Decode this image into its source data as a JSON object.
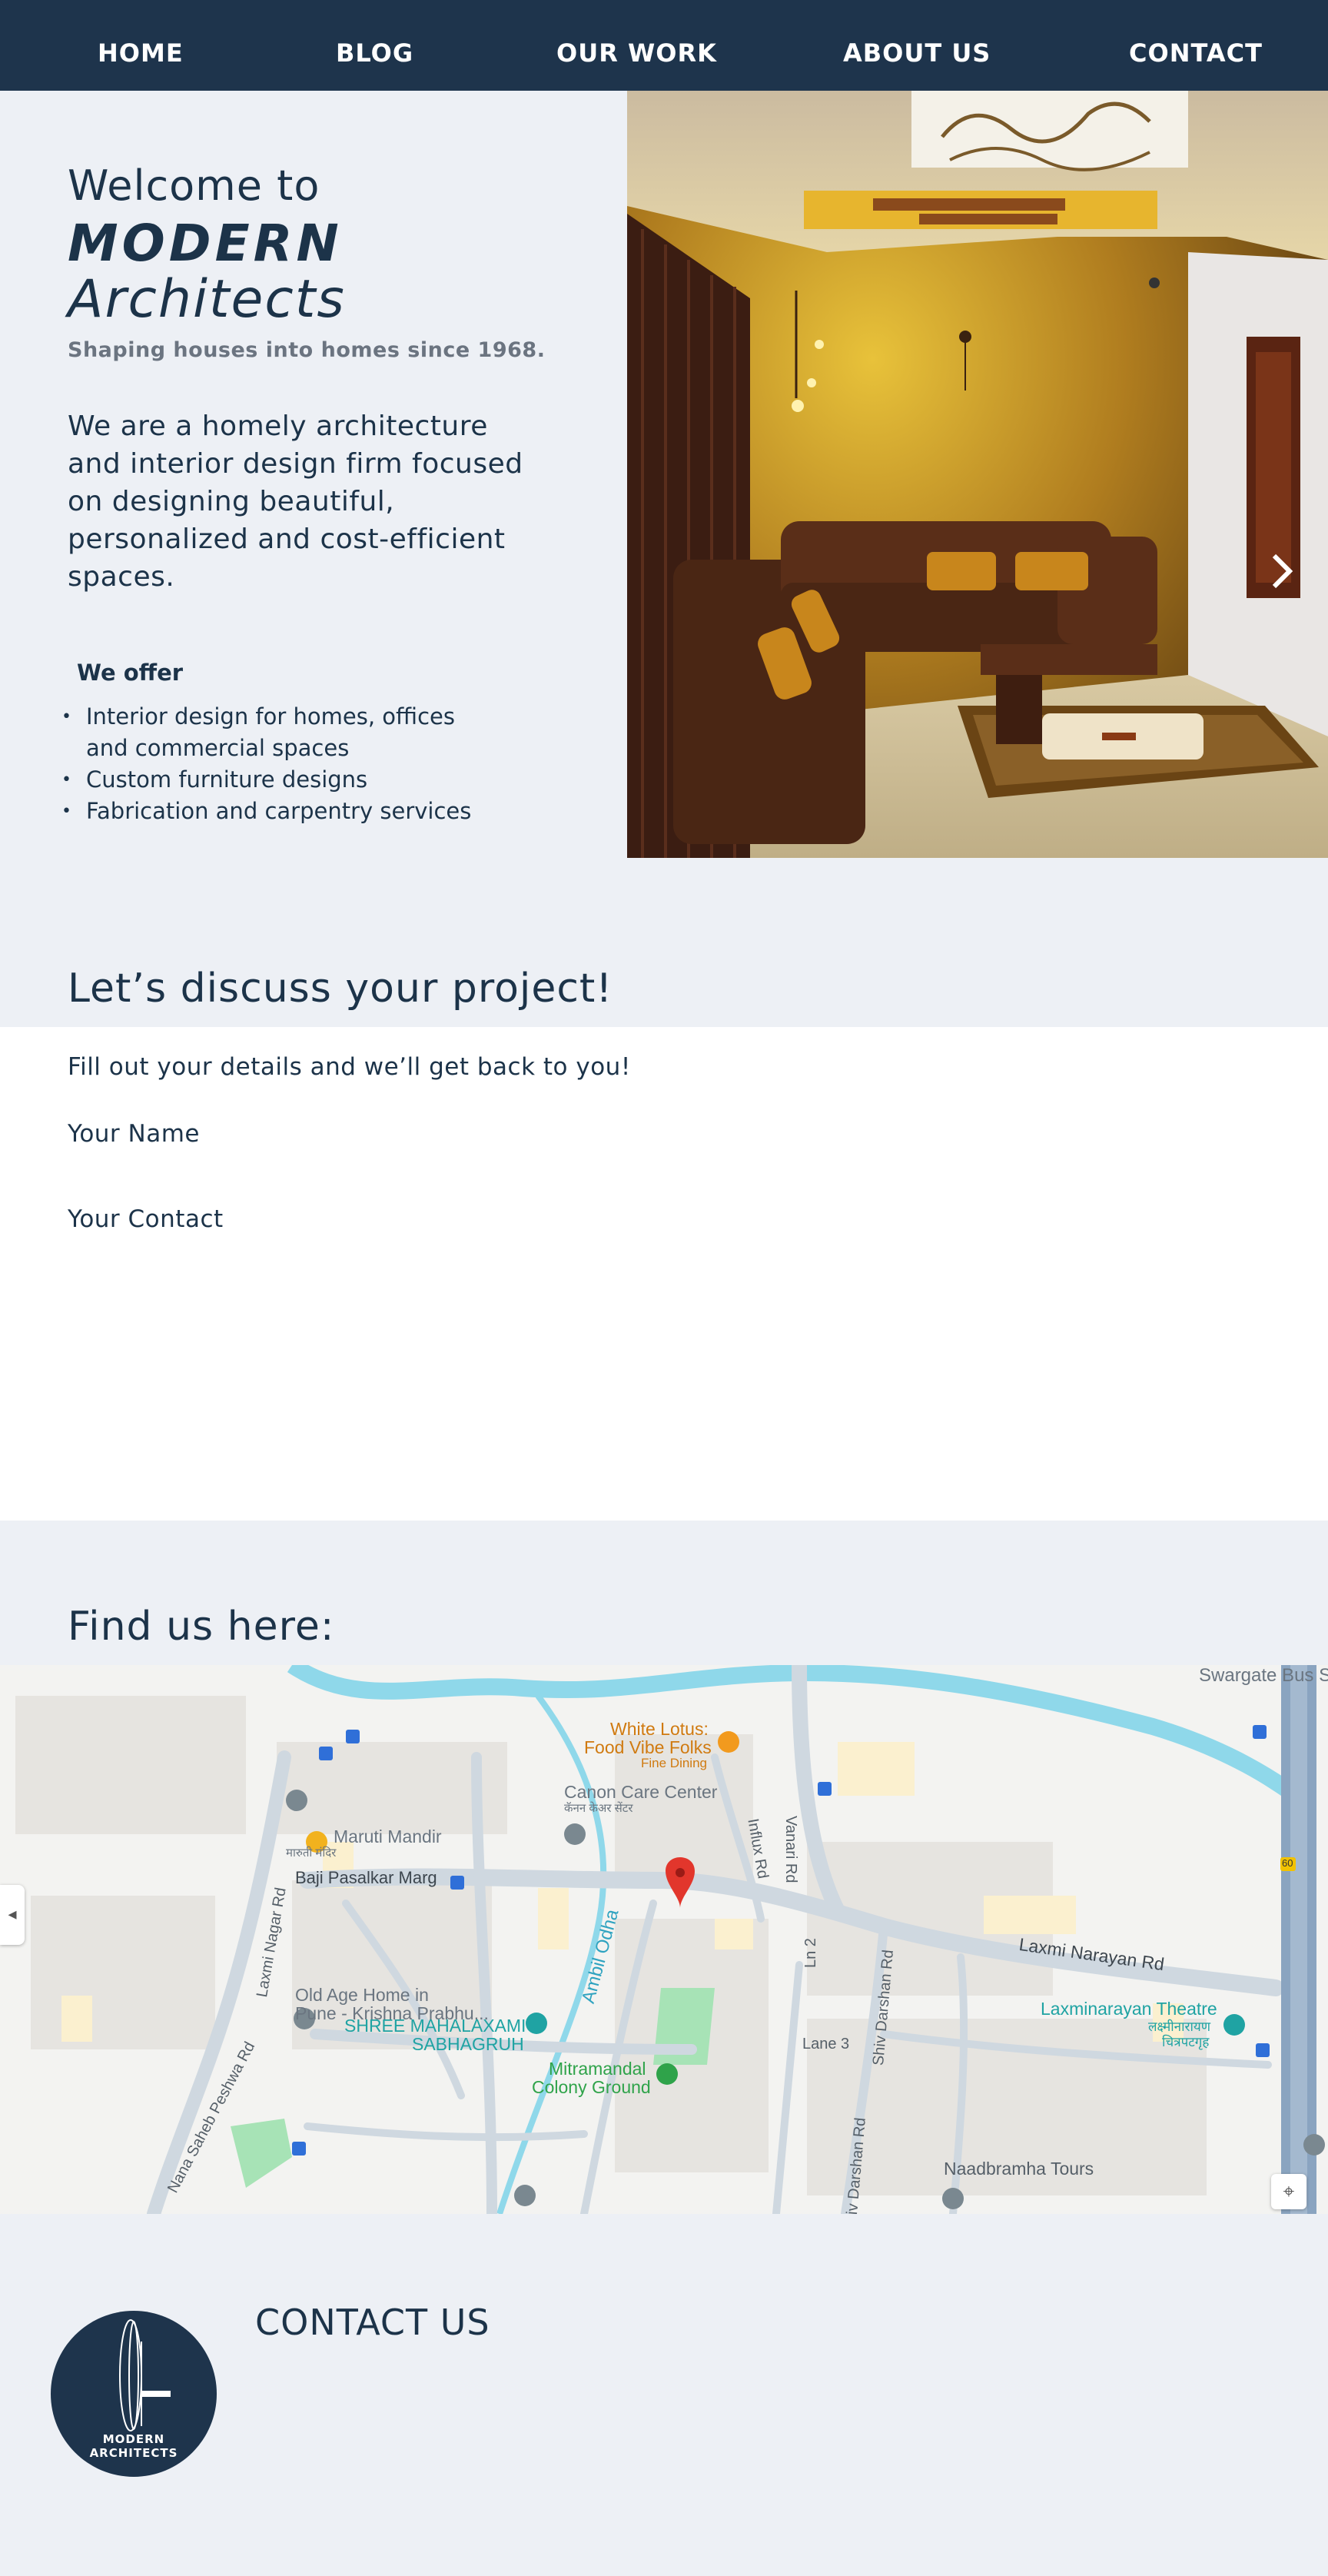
{
  "nav": {
    "items": [
      "HOME",
      "BLOG",
      "OUR WORK",
      "ABOUT US",
      "CONTACT"
    ]
  },
  "hero": {
    "welcome": "Welcome to",
    "brand_line1": "MODERN",
    "brand_line2": "Architects",
    "tagline": "Shaping houses into homes since 1968.",
    "intro": "We are a homely architecture and interior design firm focused on designing beautiful, personalized and cost-efficient spaces.",
    "offer_title": "We offer",
    "offers": [
      "Interior design for homes, offices and commercial spaces",
      "Custom furniture designs",
      "Fabrication and carpentry services"
    ],
    "slider_next": "›"
  },
  "form": {
    "title": "Let’s discuss your project!",
    "subtitle": "Fill out your details and we’ll get back to you!",
    "name_label": "Your Name",
    "contact_label": "Your Contact"
  },
  "map": {
    "title": "Find us here:",
    "labels": {
      "swargate": "Swargate Bus St",
      "white_lotus": "White Lotus:",
      "food_vibe": "Food Vibe Folks",
      "fine_dining": "Fine Dining",
      "canon": "Canon Care Center",
      "canon_local": "कॅनन केअर सेंटर",
      "vanari": "Vanari Rd",
      "influx": "Influx Rd",
      "maruti": "Maruti Mandir",
      "maruti_local": "मारुती मंदिर",
      "baji": "Baji Pasalkar Marg",
      "laxmi_nagar": "Laxmi Nagar Rd",
      "ambil": "Ambil Odha",
      "ln2": "Ln 2",
      "shiv": "Shiv Darshan Rd",
      "laxmi_narayan": "Laxmi Narayan Rd",
      "old_age": "Old Age Home in",
      "old_age2": "Pune - Krishna Prabhu...",
      "shree": "SHREE MAHALAXAMI",
      "shree2": "SABHAGRUH",
      "laxminarayan_theatre": "Laxminarayan Theatre",
      "laxminarayan_local": "लक्ष्मीनारायण",
      "laxminarayan_local2": "चित्रपटगृह",
      "lane3": "Lane 3",
      "mitramandal": "Mitramandal",
      "mitramandal2": "Colony Ground",
      "nana": "Nana Saheb Peshwa Rd",
      "naadbramha": "Naadbramha Tours",
      "iv_darshan": "iv Darshan Rd",
      "road60": "60"
    }
  },
  "footer": {
    "logo_line1": "MODERN",
    "logo_line2": "ARCHITECTS",
    "contact_title": "CONTACT US"
  },
  "colors": {
    "navy": "#1e344c",
    "background": "#edf0f5",
    "text": "#1c3349",
    "muted": "#6b7480"
  }
}
